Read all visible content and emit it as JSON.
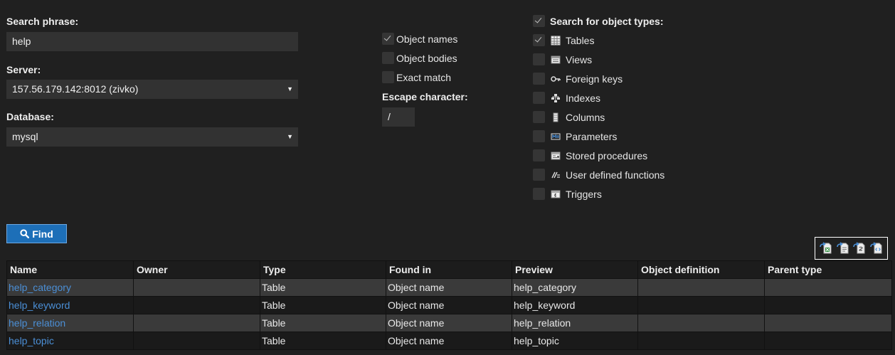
{
  "search": {
    "phrase_label": "Search phrase:",
    "phrase_value": "help",
    "server_label": "Server:",
    "server_value": "157.56.179.142:8012 (zivko)",
    "database_label": "Database:",
    "database_value": "mysql"
  },
  "options": {
    "object_names": {
      "label": "Object names",
      "checked": true
    },
    "object_bodies": {
      "label": "Object bodies",
      "checked": false
    },
    "exact_match": {
      "label": "Exact match",
      "checked": false
    },
    "escape_label": "Escape character:",
    "escape_value": "/"
  },
  "object_types": {
    "header": "Search for object types:",
    "items": [
      {
        "label": "Tables",
        "checked": true,
        "icon": "table-icon"
      },
      {
        "label": "Views",
        "checked": false,
        "icon": "view-icon"
      },
      {
        "label": "Foreign keys",
        "checked": false,
        "icon": "foreign-key-icon"
      },
      {
        "label": "Indexes",
        "checked": false,
        "icon": "index-icon"
      },
      {
        "label": "Columns",
        "checked": false,
        "icon": "column-icon"
      },
      {
        "label": "Parameters",
        "checked": false,
        "icon": "parameter-icon"
      },
      {
        "label": "Stored procedures",
        "checked": false,
        "icon": "stored-procedure-icon"
      },
      {
        "label": "User defined functions",
        "checked": false,
        "icon": "function-icon"
      },
      {
        "label": "Triggers",
        "checked": false,
        "icon": "trigger-icon"
      }
    ]
  },
  "find_button": {
    "label": "Find",
    "icon": "search-icon"
  },
  "export_icons": [
    "export-excel-icon",
    "export-csv-icon",
    "export-text-icon",
    "export-xml-icon"
  ],
  "results": {
    "columns": [
      "Name",
      "Owner",
      "Type",
      "Found in",
      "Preview",
      "Object definition",
      "Parent type"
    ],
    "rows": [
      [
        "help_category",
        "",
        "Table",
        "Object name",
        "help_category",
        "",
        ""
      ],
      [
        "help_keyword",
        "",
        "Table",
        "Object name",
        "help_keyword",
        "",
        ""
      ],
      [
        "help_relation",
        "",
        "Table",
        "Object name",
        "help_relation",
        "",
        ""
      ],
      [
        "help_topic",
        "",
        "Table",
        "Object name",
        "help_topic",
        "",
        ""
      ]
    ]
  },
  "colors": {
    "background": "#202020",
    "accent": "#1d6fb8",
    "link": "#4b8fd6"
  }
}
